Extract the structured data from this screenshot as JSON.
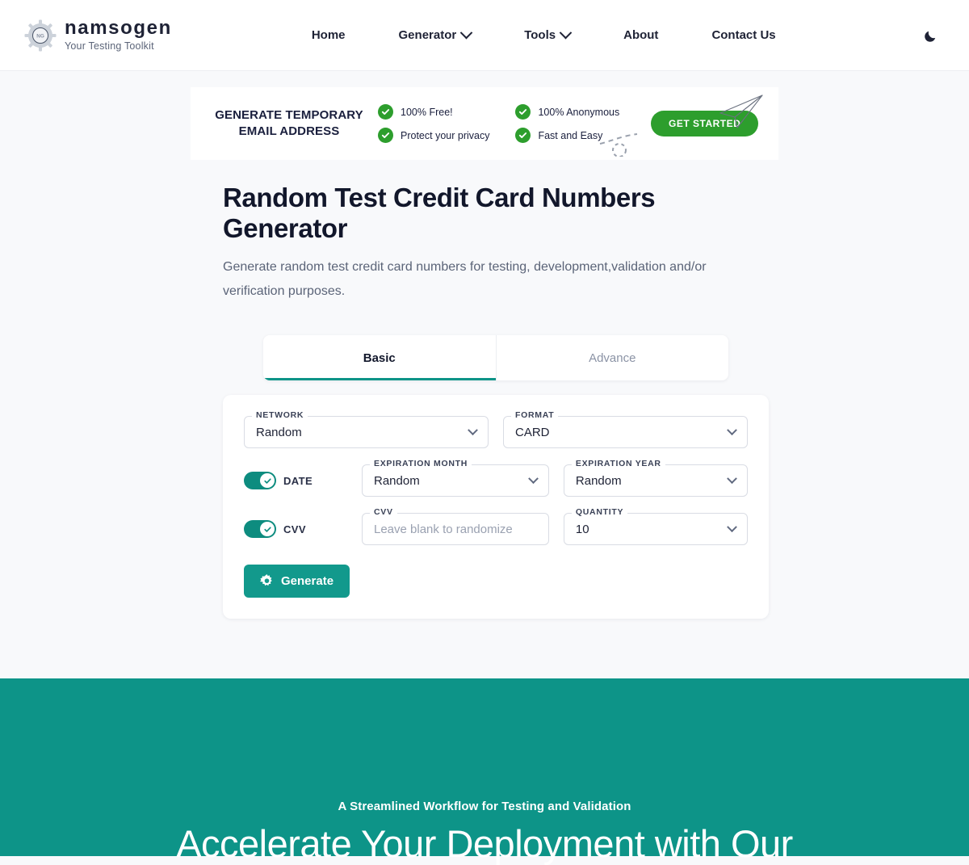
{
  "header": {
    "brand_name": "namsogen",
    "brand_tagline": "Your Testing Toolkit",
    "logo_initials": "NG",
    "nav": [
      {
        "label": "Home",
        "has_caret": false
      },
      {
        "label": "Generator",
        "has_caret": true
      },
      {
        "label": "Tools",
        "has_caret": true
      },
      {
        "label": "About",
        "has_caret": false
      },
      {
        "label": "Contact Us",
        "has_caret": false
      }
    ],
    "theme_toggle_icon": "moon-icon"
  },
  "ad_banner": {
    "title_line1": "GENERATE TEMPORARY",
    "title_line2": "EMAIL ADDRESS",
    "features_col1": [
      "100% Free!",
      "Protect your privacy"
    ],
    "features_col2": [
      "100% Anonymous",
      "Fast and Easy"
    ],
    "cta_label": "GET STARTED",
    "cta_color": "#2d9e2d",
    "check_icon": "check-circle-icon",
    "plane_icon": "paper-plane-icon"
  },
  "main": {
    "title": "Random Test Credit Card Numbers Generator",
    "subtitle": "Generate random test credit card numbers for testing, development,validation and/or verification purposes.",
    "tabs": [
      {
        "label": "Basic",
        "active": true
      },
      {
        "label": "Advance",
        "active": false
      }
    ],
    "accent_color": "#0d9488",
    "form": {
      "network": {
        "label": "NETWORK",
        "value": "Random"
      },
      "format": {
        "label": "FORMAT",
        "value": "CARD"
      },
      "date_toggle": {
        "label": "DATE",
        "enabled": true
      },
      "expiration_month": {
        "label": "EXPIRATION MONTH",
        "value": "Random"
      },
      "expiration_year": {
        "label": "EXPIRATION YEAR",
        "value": "Random"
      },
      "cvv_toggle": {
        "label": "CVV",
        "enabled": true
      },
      "cvv": {
        "label": "CVV",
        "value": "",
        "placeholder": "Leave blank to randomize"
      },
      "quantity": {
        "label": "QUANTITY",
        "value": "10"
      },
      "generate_label": "Generate",
      "generate_icon": "gear-icon"
    }
  },
  "promo_section": {
    "eyebrow": "A Streamlined Workflow for Testing and Validation",
    "heading": "Accelerate Your Deployment with Our",
    "background_color": "#0d9488"
  }
}
